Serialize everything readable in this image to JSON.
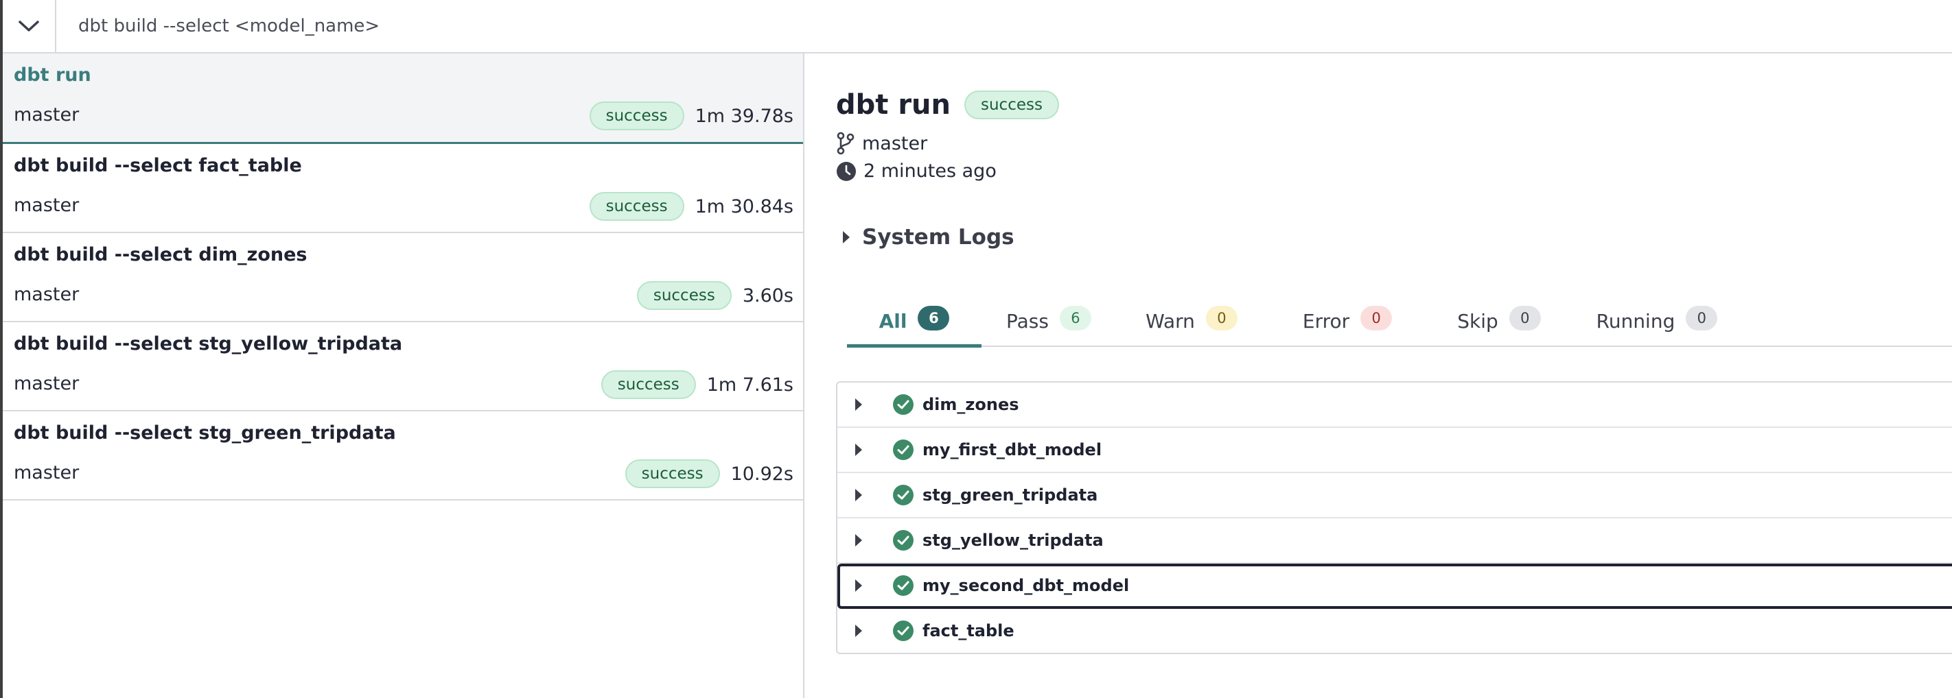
{
  "command_bar": {
    "placeholder": "dbt build --select <model_name>",
    "chevron_icon": "chevron-down-icon"
  },
  "runs": [
    {
      "title": "dbt run",
      "branch": "master",
      "status": "success",
      "duration": "1m 39.78s",
      "active": true
    },
    {
      "title": "dbt build --select fact_table",
      "branch": "master",
      "status": "success",
      "duration": "1m 30.84s"
    },
    {
      "title": "dbt build --select dim_zones",
      "branch": "master",
      "status": "success",
      "duration": "3.60s"
    },
    {
      "title": "dbt build --select stg_yellow_tripdata",
      "branch": "master",
      "status": "success",
      "duration": "1m 7.61s"
    },
    {
      "title": "dbt build --select stg_green_tripdata",
      "branch": "master",
      "status": "success",
      "duration": "10.92s"
    }
  ],
  "detail": {
    "title": "dbt run",
    "status": "success",
    "branch": "master",
    "time_ago": "2 minutes ago",
    "system_logs_label": "System Logs",
    "tabs": [
      {
        "label": "All",
        "count": "6"
      },
      {
        "label": "Pass",
        "count": "6"
      },
      {
        "label": "Warn",
        "count": "0"
      },
      {
        "label": "Error",
        "count": "0"
      },
      {
        "label": "Skip",
        "count": "0"
      },
      {
        "label": "Running",
        "count": "0"
      }
    ],
    "models": [
      {
        "name": "dim_zones",
        "status": "pass"
      },
      {
        "name": "my_first_dbt_model",
        "status": "pass"
      },
      {
        "name": "stg_green_tripdata",
        "status": "pass"
      },
      {
        "name": "stg_yellow_tripdata",
        "status": "pass"
      },
      {
        "name": "my_second_dbt_model",
        "status": "pass"
      },
      {
        "name": "fact_table",
        "status": "pass"
      }
    ]
  },
  "colors": {
    "accent": "#3b7d7e",
    "success_bg": "#d8f3e3",
    "success_icon": "#3d8a67",
    "border": "#d8d9dd"
  }
}
